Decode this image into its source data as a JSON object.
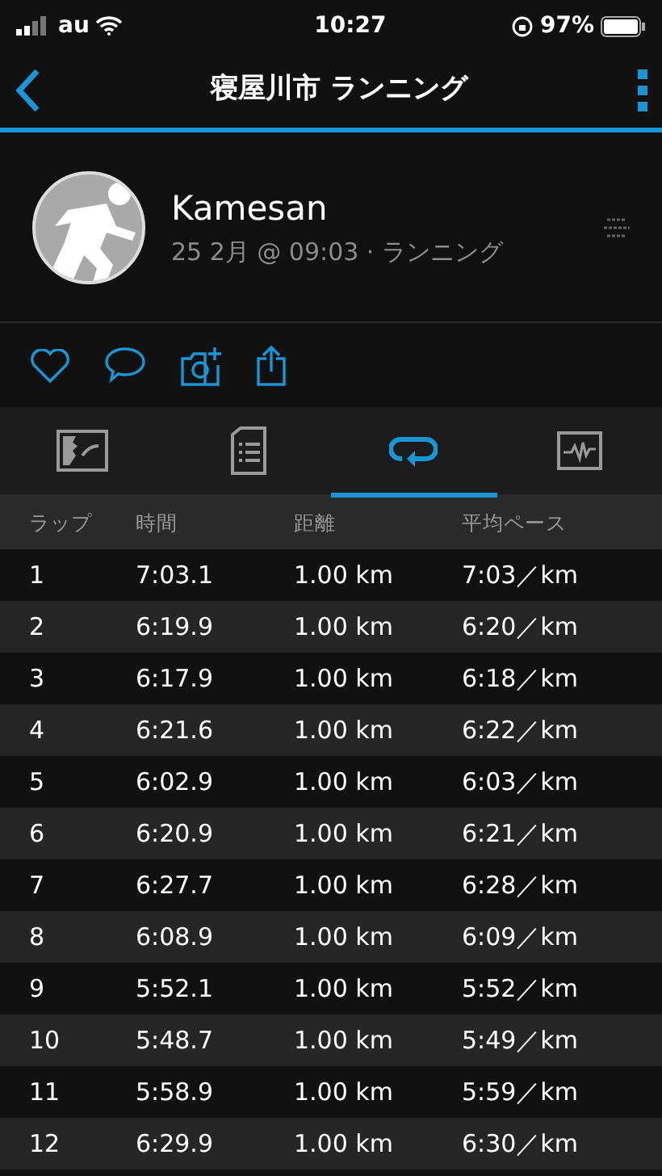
{
  "status_bar": {
    "carrier": "au",
    "time": "10:27",
    "battery": "97%"
  },
  "nav": {
    "title": "寝屋川市 ランニング"
  },
  "profile": {
    "name": "Kamesan",
    "subtitle": "25 2月 @ 09:03 · ランニング"
  },
  "tabs": [
    {
      "kind": "map",
      "selected": false
    },
    {
      "kind": "details",
      "selected": false
    },
    {
      "kind": "laps",
      "selected": true
    },
    {
      "kind": "chart",
      "selected": false
    }
  ],
  "table": {
    "columns": [
      "ラップ",
      "時間",
      "距離",
      "平均ペース"
    ],
    "rows": [
      [
        "1",
        "7:03.1",
        "1.00 km",
        "7:03／km"
      ],
      [
        "2",
        "6:19.9",
        "1.00 km",
        "6:20／km"
      ],
      [
        "3",
        "6:17.9",
        "1.00 km",
        "6:18／km"
      ],
      [
        "4",
        "6:21.6",
        "1.00 km",
        "6:22／km"
      ],
      [
        "5",
        "6:02.9",
        "1.00 km",
        "6:03／km"
      ],
      [
        "6",
        "6:20.9",
        "1.00 km",
        "6:21／km"
      ],
      [
        "7",
        "6:27.7",
        "1.00 km",
        "6:28／km"
      ],
      [
        "8",
        "6:08.9",
        "1.00 km",
        "6:09／km"
      ],
      [
        "9",
        "5:52.1",
        "1.00 km",
        "5:52／km"
      ],
      [
        "10",
        "5:48.7",
        "1.00 km",
        "5:49／km"
      ],
      [
        "11",
        "5:58.9",
        "1.00 km",
        "5:59／km"
      ],
      [
        "12",
        "6:29.9",
        "1.00 km",
        "6:30／km"
      ]
    ]
  }
}
